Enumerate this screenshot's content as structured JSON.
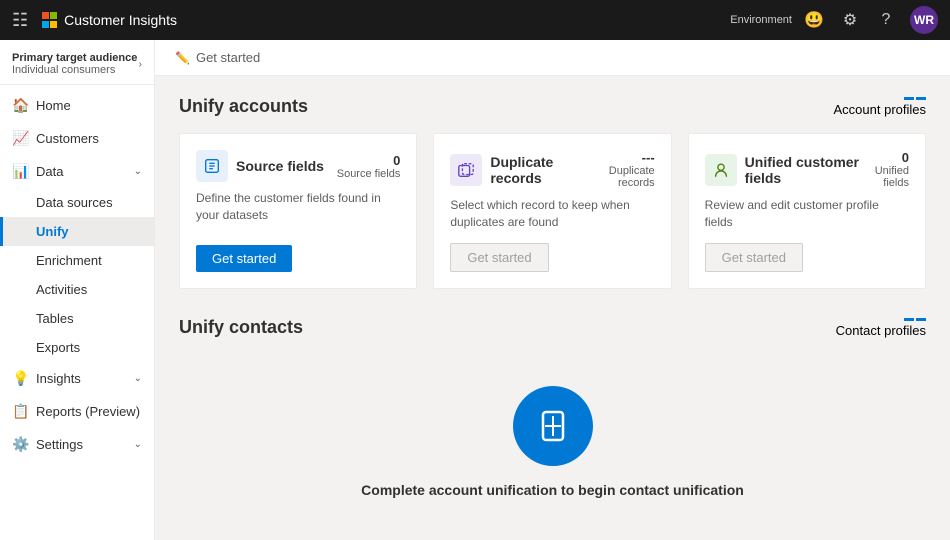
{
  "topbar": {
    "app_name": "Customer Insights",
    "env_label": "Environment",
    "avatar_initials": "WR"
  },
  "sidebar": {
    "primary_audience_title": "Primary target audience",
    "primary_audience_sub": "Individual consumers",
    "items": [
      {
        "id": "home",
        "label": "Home",
        "icon": "🏠"
      },
      {
        "id": "customers",
        "label": "Customers",
        "icon": "👥"
      },
      {
        "id": "data",
        "label": "Data",
        "icon": "📊",
        "has_chevron": true,
        "expanded": true
      },
      {
        "id": "data-sources",
        "label": "Data sources",
        "sub": true
      },
      {
        "id": "unify",
        "label": "Unify",
        "sub": true,
        "active": true
      },
      {
        "id": "enrichment",
        "label": "Enrichment",
        "sub": true
      },
      {
        "id": "activities",
        "label": "Activities",
        "sub": true
      },
      {
        "id": "tables",
        "label": "Tables",
        "sub": true
      },
      {
        "id": "exports",
        "label": "Exports",
        "sub": true
      },
      {
        "id": "insights",
        "label": "Insights",
        "icon": "💡",
        "has_chevron": true
      },
      {
        "id": "reports",
        "label": "Reports (Preview)",
        "icon": "📋"
      },
      {
        "id": "settings",
        "label": "Settings",
        "icon": "⚙️",
        "has_chevron": true
      }
    ]
  },
  "breadcrumb": "Get started",
  "unify_accounts": {
    "title": "Unify accounts",
    "profile_link": "Account profiles",
    "cards": [
      {
        "id": "source-fields",
        "title": "Source fields",
        "icon_type": "source",
        "count": "0",
        "count_label": "Source fields",
        "description": "Define the customer fields found in your datasets",
        "action_label": "Get started",
        "action_type": "primary"
      },
      {
        "id": "duplicate-records",
        "title": "Duplicate records",
        "icon_type": "duplicate",
        "count": "---",
        "count_label": "Duplicate records",
        "description": "Select which record to keep when duplicates are found",
        "action_label": "Get started",
        "action_type": "secondary"
      },
      {
        "id": "unified-fields",
        "title": "Unified customer fields",
        "icon_type": "unified",
        "count": "0",
        "count_label": "Unified fields",
        "description": "Review and edit customer profile fields",
        "action_label": "Get started",
        "action_type": "secondary"
      }
    ]
  },
  "unify_contacts": {
    "title": "Unify contacts",
    "profile_link": "Contact profiles",
    "placeholder_text": "Complete account unification to begin contact unification"
  }
}
